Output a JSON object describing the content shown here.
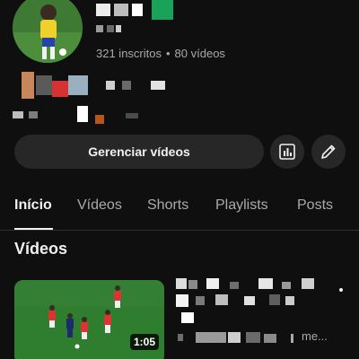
{
  "channel": {
    "subscribers": "321 inscritos",
    "separator": "•",
    "videos_count": "80 vídeos"
  },
  "actions": {
    "manage_label": "Gerenciar vídeos",
    "analytics_icon": "bar-chart-icon",
    "edit_icon": "pencil-icon"
  },
  "tabs": [
    {
      "label": "Início",
      "active": true
    },
    {
      "label": "Vídeos",
      "active": false
    },
    {
      "label": "Shorts",
      "active": false
    },
    {
      "label": "Playlists",
      "active": false
    },
    {
      "label": "Posts",
      "active": false
    }
  ],
  "section": {
    "title": "Vídeos"
  },
  "video": {
    "duration": "1:05",
    "more": "me..."
  },
  "colors": {
    "background": "#0f0f0f",
    "surface": "#272727",
    "text_primary": "#f1f1f1",
    "text_secondary": "#aaaaaa"
  }
}
